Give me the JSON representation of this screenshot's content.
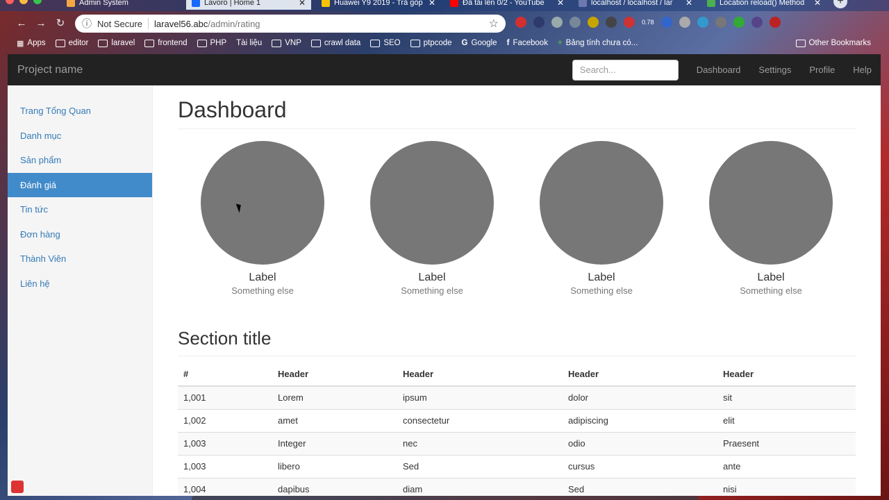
{
  "browser": {
    "tabs": [
      {
        "title": "Admin System",
        "fav": "#f3a642"
      },
      {
        "title": "Lavoro | Home 1",
        "fav": "#1769ff"
      },
      {
        "title": "Huawei Y9 2019 - Trả góp",
        "fav": "#f2c500"
      },
      {
        "title": "Đã tải lên 0/2 - YouTube",
        "fav": "#ff0000"
      },
      {
        "title": "localhost / localhost / lar",
        "fav": "#6c78af"
      },
      {
        "title": "Location reload() Method",
        "fav": "#4caf50"
      }
    ],
    "security_label": "Not Secure",
    "url_host": "laravel56.abc",
    "url_path": "/admin/rating",
    "bookmarks": [
      "Apps",
      "editor",
      "laravel",
      "frontend",
      "PHP",
      "Tài liệu",
      "VNP",
      "crawl data",
      "SEO",
      "ptpcode",
      "Google",
      "Facebook",
      "Bảng tính chưa có..."
    ],
    "other_bookmarks": "Other Bookmarks",
    "ext_badge": "0.78"
  },
  "navbar": {
    "brand": "Project name",
    "search_placeholder": "Search...",
    "links": [
      "Dashboard",
      "Settings",
      "Profile",
      "Help"
    ]
  },
  "sidebar": {
    "items": [
      "Trang Tổng Quan",
      "Danh mục",
      "Sản phẩm",
      "Đánh giá",
      "Tin tức",
      "Đơn hàng",
      "Thành Viên",
      "Liên hệ"
    ],
    "active": "Đánh giá"
  },
  "main": {
    "title": "Dashboard",
    "placeholders": [
      {
        "label": "Label",
        "sub": "Something else"
      },
      {
        "label": "Label",
        "sub": "Something else"
      },
      {
        "label": "Label",
        "sub": "Something else"
      },
      {
        "label": "Label",
        "sub": "Something else"
      }
    ],
    "section_title": "Section title",
    "table": {
      "headers": [
        "#",
        "Header",
        "Header",
        "Header",
        "Header"
      ],
      "rows": [
        [
          "1,001",
          "Lorem",
          "ipsum",
          "dolor",
          "sit"
        ],
        [
          "1,002",
          "amet",
          "consectetur",
          "adipiscing",
          "elit"
        ],
        [
          "1,003",
          "Integer",
          "nec",
          "odio",
          "Praesent"
        ],
        [
          "1,003",
          "libero",
          "Sed",
          "cursus",
          "ante"
        ],
        [
          "1,004",
          "dapibus",
          "diam",
          "Sed",
          "nisi"
        ]
      ]
    }
  }
}
